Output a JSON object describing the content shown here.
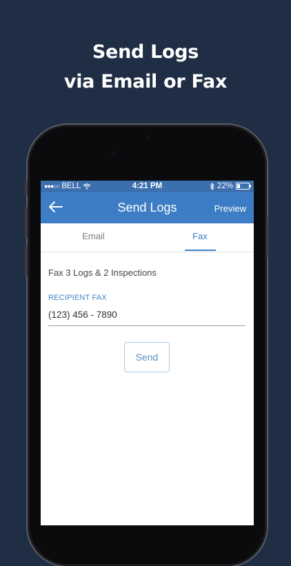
{
  "headline": {
    "line1": "Send Logs",
    "line2": "via Email or Fax"
  },
  "status_bar": {
    "signal": "●●●○○",
    "carrier": "BELL",
    "time": "4:21 PM",
    "battery_percent": "22%",
    "battery_level": 0.22
  },
  "nav": {
    "title": "Send Logs",
    "preview_label": "Preview"
  },
  "tabs": [
    {
      "label": "Email",
      "selected": false
    },
    {
      "label": "Fax",
      "selected": true
    }
  ],
  "form": {
    "summary": "Fax 3 Logs & 2 Inspections",
    "recipient_label": "RECIPIENT FAX",
    "recipient_value": "(123) 456 - 7890",
    "send_label": "Send"
  },
  "colors": {
    "background": "#1f2e44",
    "navbar": "#3d7dc5",
    "statusbar": "#3b6fae",
    "accent": "#3b82c6"
  },
  "icons": [
    "back-arrow-icon",
    "wifi-icon",
    "bluetooth-icon",
    "battery-icon"
  ]
}
